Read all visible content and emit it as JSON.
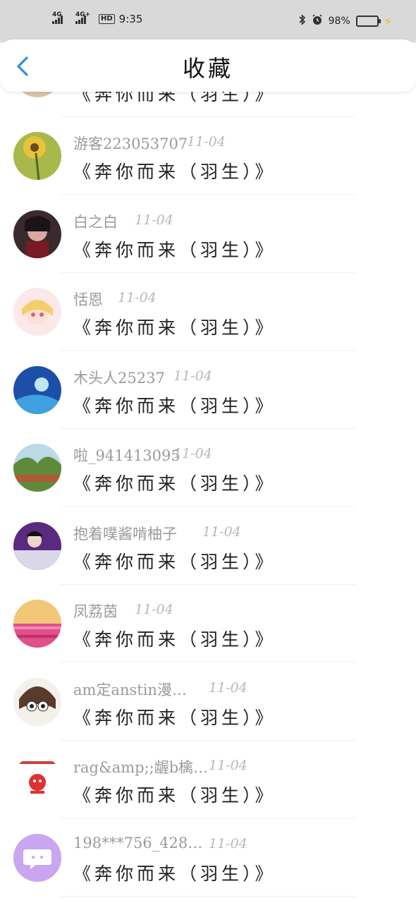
{
  "status_bar": {
    "network1": "4G",
    "network2": "4G+",
    "hd": "HD",
    "time": "9:35",
    "battery": "98%",
    "battery_level": 0.98
  },
  "header": {
    "title": "收藏"
  },
  "partial_item": {
    "message": "《奔你而来（羽生）》"
  },
  "items": [
    {
      "name": "游客223053707",
      "date": "11-04",
      "message": "《奔你而来（羽生）》"
    },
    {
      "name": "白之白",
      "date": "11-04",
      "message": "《奔你而来（羽生）》"
    },
    {
      "name": "恬恩",
      "date": "11-04",
      "message": "《奔你而来（羽生）》"
    },
    {
      "name": "木头人25237",
      "date": "11-04",
      "message": "《奔你而来（羽生）》"
    },
    {
      "name": "啦_941413095",
      "date": "11-04",
      "message": "《奔你而来（羽生）》"
    },
    {
      "name": "抱着噗酱啃柚子",
      "date": "11-04",
      "message": "《奔你而来（羽生）》"
    },
    {
      "name": "凤荔茵",
      "date": "11-04",
      "message": "《奔你而来（羽生）》"
    },
    {
      "name": "am定anstin漫…",
      "date": "11-04",
      "message": "《奔你而来（羽生）》"
    },
    {
      "name": "rag&amp;;龌b檎…",
      "date": "11-04",
      "message": "《奔你而来（羽生）》"
    },
    {
      "name": "198***756_428…",
      "date": "11-04",
      "message": "《奔你而来（羽生）》"
    }
  ]
}
